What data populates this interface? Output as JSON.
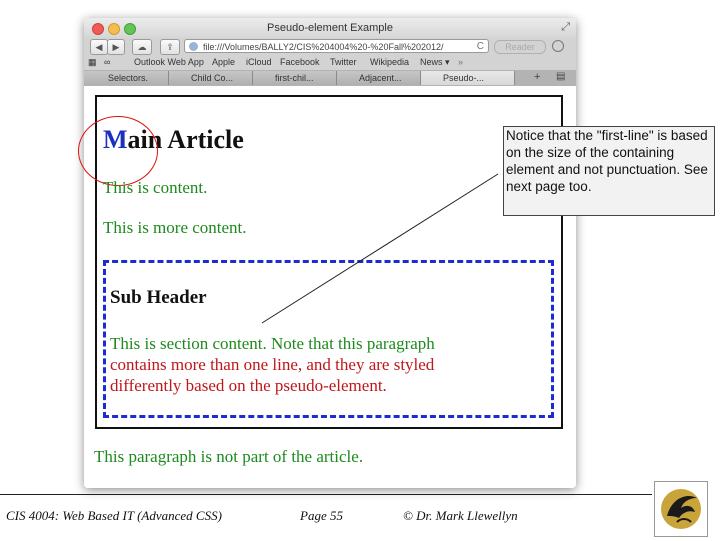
{
  "browser": {
    "title": "Pseudo-element Example",
    "url": "file:///Volumes/BALLY2/CIS%204004%20-%20Fall%202012/",
    "reader_label": "Reader",
    "bookmarks": [
      "Outlook Web App",
      "Apple",
      "iCloud",
      "Facebook",
      "Twitter",
      "Wikipedia",
      "News ▾"
    ],
    "tabs": [
      "Selectors.",
      "Child Co...",
      "first-chil...",
      "Adjacent...",
      "Pseudo-..."
    ],
    "active_tab_index": 4
  },
  "page": {
    "heading_first_letter": "M",
    "heading_rest": "ain Article",
    "para1": "This is content.",
    "para2": "This is more content.",
    "subheader": "Sub Header",
    "section_line1": "This is section content. Note that this paragraph",
    "section_line2": "contains more than one line, and they are styled",
    "section_line3": "differently based on the pseudo-element.",
    "outside_para": "This paragraph is not part of the article."
  },
  "callout": {
    "text": "Notice that the \"first-line\" is based on the size of the containing element and not punctuation.  See next page too."
  },
  "footer": {
    "course": "CIS 4004: Web Based IT (Advanced CSS)",
    "page": "Page 55",
    "author": "© Dr. Mark Llewellyn"
  },
  "colors": {
    "first_letter": "#1d2fbf",
    "first_line": "#1d8a1d",
    "other_lines": "#c0161a",
    "section_border": "#1c2bd4",
    "circle": "#d11"
  }
}
